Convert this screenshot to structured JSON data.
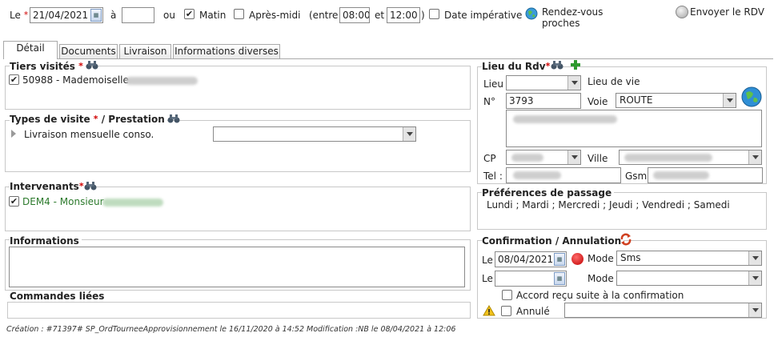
{
  "top": {
    "le_label": "Le",
    "date_value": "21/04/2021",
    "a_label": "à",
    "date_to_value": "",
    "ou_label": "ou",
    "matin_label": "Matin",
    "matin_checked": true,
    "apres_midi_label": "Après-midi",
    "apres_midi_checked": false,
    "entre_label": "(entre",
    "time_from": "08:00",
    "et_label": "et",
    "time_to": "12:00",
    "close_paren": ")",
    "date_imperative_label": "Date impérative",
    "rdv_proches_line1": "Rendez-vous",
    "rdv_proches_line2": "proches",
    "send_rdv_label": "Envoyer le RDV"
  },
  "tabs": [
    {
      "label": "Détail",
      "active": true
    },
    {
      "label": "Documents",
      "active": false
    },
    {
      "label": "Livraison",
      "active": false
    },
    {
      "label": "Informations diverses",
      "active": false
    }
  ],
  "tiers": {
    "title": "Tiers visités",
    "required_mark": "*",
    "item_label": "50988 - Mademoiselle",
    "item_checked": true
  },
  "types": {
    "title": "Types de visite",
    "title_rest": " / Prestation",
    "required_mark": "*",
    "item_label": "Livraison mensuelle conso.",
    "select_value": ""
  },
  "intervenants": {
    "title": "Intervenants",
    "required_mark": "*",
    "item_label": "DEM4 - Monsieur",
    "item_checked": true
  },
  "informations": {
    "title": "Informations"
  },
  "commandes": {
    "title": "Commandes liées"
  },
  "lieu": {
    "title": "Lieu du Rdv",
    "required_mark": "*",
    "lieu_label": "Lieu",
    "lieu_value": "",
    "lieu_de_vie_label": "Lieu de vie",
    "no_label": "N°",
    "no_value": "3793",
    "voie_label": "Voie",
    "voie_value": "ROUTE",
    "cp_label": "CP",
    "ville_label": "Ville",
    "tel_label": "Tel :",
    "gsm_label": "Gsm"
  },
  "preferences": {
    "title": "Préférences de passage",
    "days": "Lundi ; Mardi ; Mercredi ; Jeudi ; Vendredi ; Samedi"
  },
  "confirmation": {
    "title": "Confirmation / Annulation",
    "le_label": "Le",
    "le_value": "08/04/2021",
    "mode_label": "Mode",
    "mode_value": "Sms",
    "le2_label": "Le",
    "le2_value": "",
    "mode2_label": "Mode",
    "mode2_value": "",
    "accord_label": "Accord reçu suite à la confirmation",
    "annule_label": "Annulé",
    "annule_value": ""
  },
  "footer": {
    "text": "Création : #71397# SP_OrdTourneeApprovisionnement le 16/11/2020 à 14:52 Modification :NB le 08/04/2021 à 12:06"
  },
  "colors": {
    "required": "#d00000",
    "intervenant_text": "#2c7a2c",
    "plus_green": "#2e9a2e",
    "red_dot": "#e02020"
  },
  "icons": [
    "calendar-icon",
    "binoculars-icon",
    "add-icon",
    "globe-icon",
    "refresh-icon",
    "warning-icon",
    "status-red-icon",
    "expand-arrow-icon"
  ]
}
